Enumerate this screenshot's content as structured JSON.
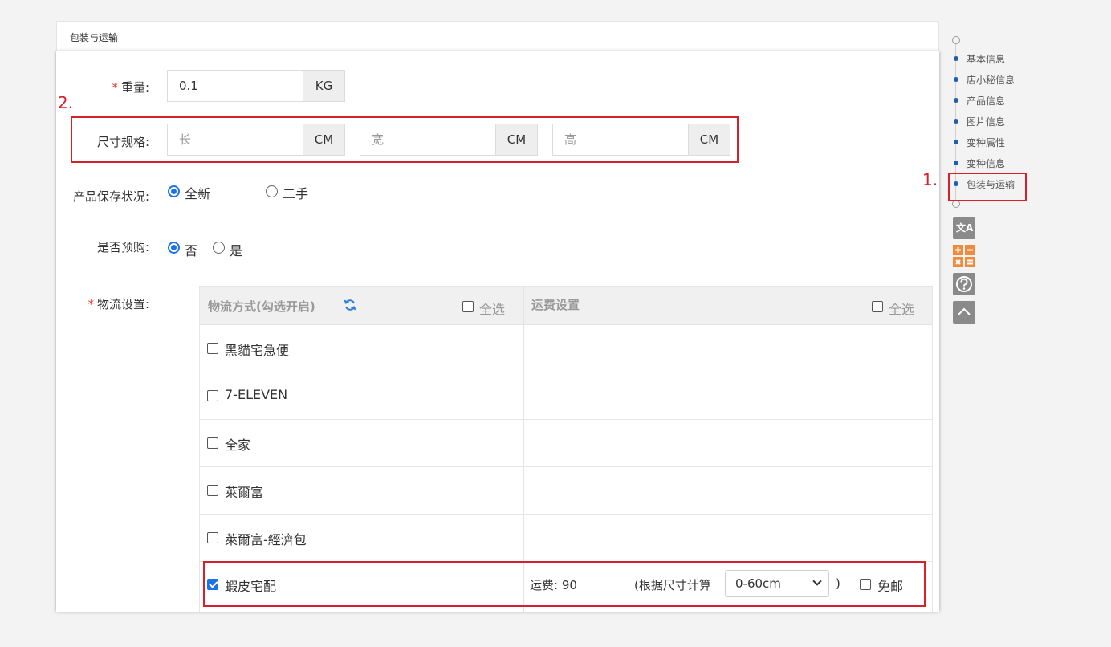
{
  "panel": {
    "title": "包装与运输"
  },
  "weight": {
    "label": "重量:",
    "value": "0.1",
    "unit": "KG"
  },
  "dimensions": {
    "label": "尺寸规格:",
    "length_placeholder": "长",
    "width_placeholder": "宽",
    "height_placeholder": "高",
    "unit": "CM"
  },
  "condition": {
    "label": "产品保存状况:",
    "options": [
      "全新",
      "二手"
    ],
    "selected": "全新"
  },
  "preorder": {
    "label": "是否预购:",
    "options": [
      "否",
      "是"
    ],
    "selected": "否"
  },
  "logistics": {
    "label": "物流设置:",
    "col1_header": "物流方式(勾选开启)",
    "col2_header": "运费设置",
    "select_all": "全选",
    "rows": [
      {
        "name": "黑貓宅急便",
        "checked": false
      },
      {
        "name": "7-ELEVEN",
        "checked": false
      },
      {
        "name": "全家",
        "checked": false
      },
      {
        "name": "萊爾富",
        "checked": false
      },
      {
        "name": "萊爾富-經濟包",
        "checked": false
      },
      {
        "name": "蝦皮宅配",
        "checked": true
      }
    ],
    "fee_label": "运费:",
    "fee_value": "90",
    "calc_note_open": "(根据尺寸计算",
    "size_option": "0-60cm",
    "calc_note_close": ")",
    "free_shipping": "免邮"
  },
  "annotations": {
    "step1": "1.",
    "step2": "2."
  },
  "side_nav": {
    "items": [
      "基本信息",
      "店小秘信息",
      "产品信息",
      "图片信息",
      "变种属性",
      "变种信息",
      "包装与运输"
    ],
    "active": "包装与运输"
  },
  "tools": {
    "translate_glyph": "文A"
  },
  "colors": {
    "accent": "#1a73e8",
    "highlight": "#d6202a",
    "nav_dot": "#1e5fb4"
  }
}
